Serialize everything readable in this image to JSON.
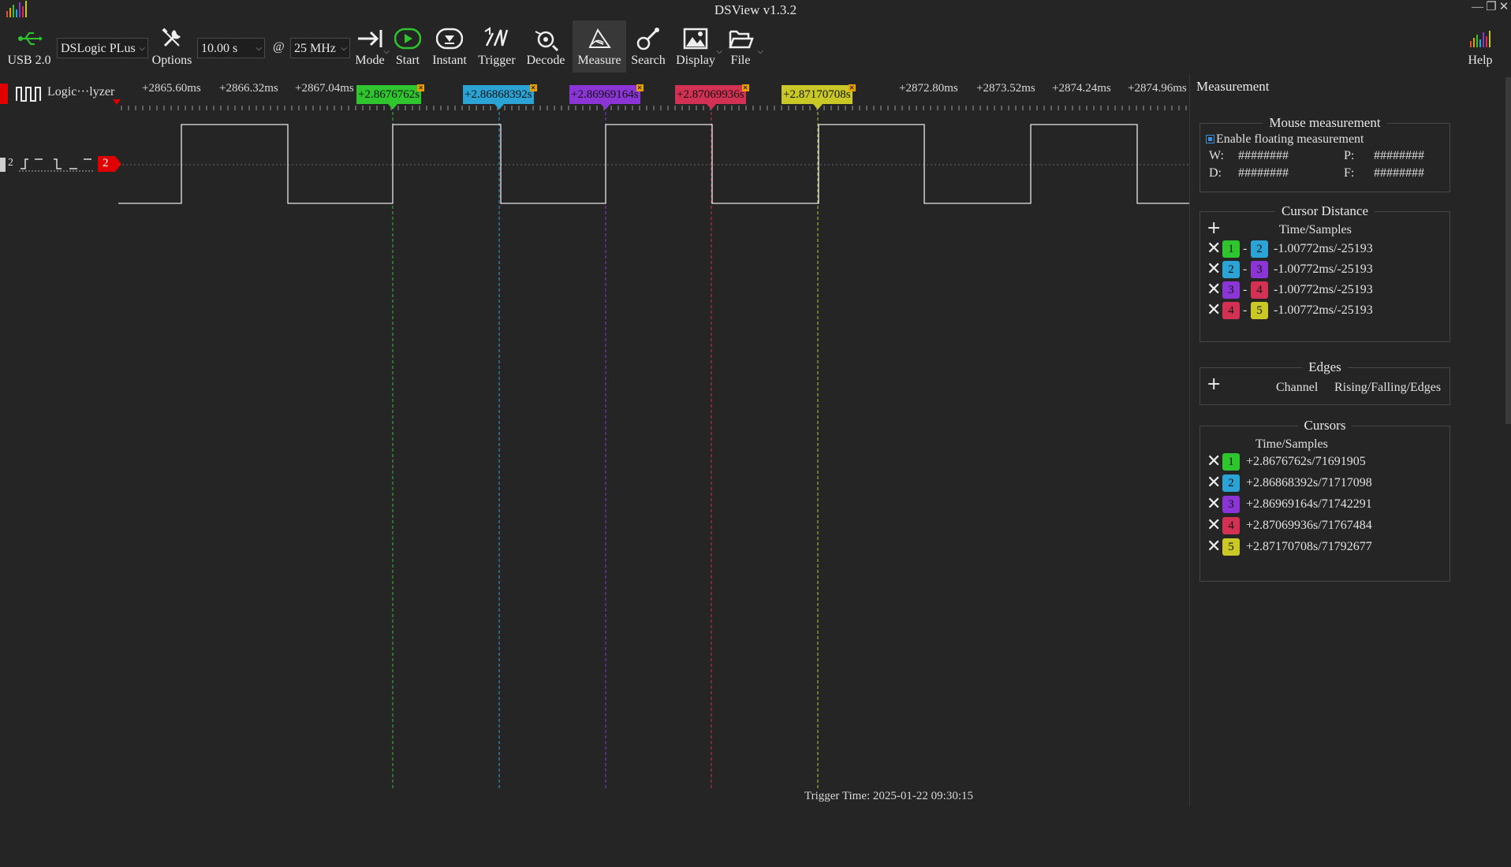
{
  "app": {
    "title": "DSView v1.3.2"
  },
  "toolbar": {
    "usb_label": "USB 2.0",
    "device": "DSLogic PLus",
    "options_label": "Options",
    "duration": "10.00 s",
    "at_sign": "@",
    "samplerate": "25 MHz",
    "mode_label": "Mode",
    "start_label": "Start",
    "instant_label": "Instant",
    "trigger_label": "Trigger",
    "decode_label": "Decode",
    "measure_label": "Measure",
    "search_label": "Search",
    "display_label": "Display",
    "file_label": "File",
    "help_label": "Help"
  },
  "ruler": {
    "ticks": [
      "+2865.60ms",
      "+2866.32ms",
      "+2867.04ms",
      "+2872.80ms",
      "+2873.52ms",
      "+2874.24ms",
      "+2874.96ms"
    ]
  },
  "cursor_flags": [
    {
      "num": "1",
      "label": "+2.8676762s",
      "color": "#2ec52e"
    },
    {
      "num": "2",
      "label": "+2.86868392s",
      "color": "#2ba3d4"
    },
    {
      "num": "3",
      "label": "+2.86969164s",
      "color": "#8b35d6"
    },
    {
      "num": "4",
      "label": "+2.87069936s",
      "color": "#d23154"
    },
    {
      "num": "5",
      "label": "+2.87170708s",
      "color": "#c9c827"
    }
  ],
  "channel": {
    "group_label": "Logic···lyzer",
    "index": "2",
    "tag": "2"
  },
  "panel": {
    "title": "Measurement",
    "mouse": {
      "title": "Mouse measurement",
      "enable_label": "Enable floating measurement",
      "w_label": "W:",
      "w_value": "########",
      "p_label": "P:",
      "p_value": "########",
      "d_label": "D:",
      "d_value": "########",
      "f_label": "F:",
      "f_value": "########"
    },
    "cursor_distance": {
      "title": "Cursor Distance",
      "header": "Time/Samples",
      "rows": [
        {
          "a": "1",
          "b": "2",
          "value": "-1.00772ms/-25193"
        },
        {
          "a": "2",
          "b": "3",
          "value": "-1.00772ms/-25193"
        },
        {
          "a": "3",
          "b": "4",
          "value": "-1.00772ms/-25193"
        },
        {
          "a": "4",
          "b": "5",
          "value": "-1.00772ms/-25193"
        }
      ],
      "dash": "-"
    },
    "edges": {
      "title": "Edges",
      "col_channel": "Channel",
      "col_edges": "Rising/Falling/Edges"
    },
    "cursors": {
      "title": "Cursors",
      "header": "Time/Samples",
      "rows": [
        {
          "num": "1",
          "value": "+2.8676762s/71691905"
        },
        {
          "num": "2",
          "value": "+2.86868392s/71717098"
        },
        {
          "num": "3",
          "value": "+2.86969164s/71742291"
        },
        {
          "num": "4",
          "value": "+2.87069936s/71767484"
        },
        {
          "num": "5",
          "value": "+2.87170708s/71792677"
        }
      ]
    }
  },
  "status": {
    "trigger_time": "Trigger Time: 2025-01-22 09:30:15"
  }
}
